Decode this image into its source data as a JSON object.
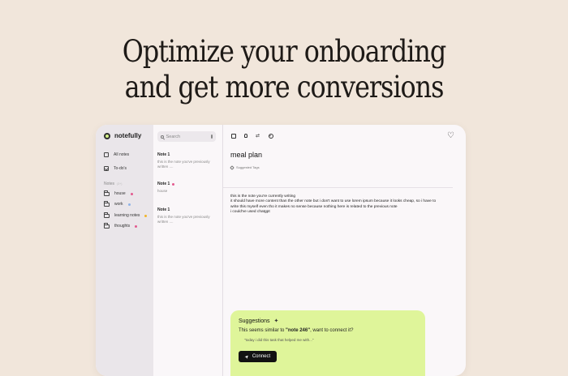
{
  "hero": {
    "line1": "Optimize your onboarding",
    "line2": "and get more conversions"
  },
  "sidebar": {
    "brand": "notefully",
    "nav": [
      {
        "label": "All notes",
        "icon": "notes-icon"
      },
      {
        "label": "To-do's",
        "icon": "checkbox-icon"
      }
    ],
    "notes_section": {
      "label": "Notes",
      "hint": "(3+)"
    },
    "folders": [
      {
        "label": "house",
        "dot_color": "#e35b8f"
      },
      {
        "label": "work",
        "dot_color": "#8fb3e8"
      },
      {
        "label": "learning notes",
        "dot_color": "#f1b52a"
      },
      {
        "label": "thoughts",
        "dot_color": "#e35b8f"
      }
    ]
  },
  "list": {
    "search_placeholder": "Search",
    "notes": [
      {
        "title": "Note 1",
        "snippet": "this is the note you've previously written ....",
        "dot_color": ""
      },
      {
        "title": "Note 1",
        "snippet": "house",
        "dot_color": "#e35b8f"
      },
      {
        "title": "Note 1",
        "snippet": "this is the note you've previously written ....",
        "dot_color": ""
      }
    ]
  },
  "editor": {
    "title": "meal plan",
    "suggested_tags": "Suggested Tags",
    "body": [
      "this is the note you're currently writing",
      "it should have more content than the other note but i don't want to use lorem ipsum because it looks cheap, so i have to",
      "write this myself even tho it makes no sense because nothing here is related to the previous note",
      "i could've used chatgpt"
    ]
  },
  "suggestions": {
    "title": "Suggestions",
    "prefix": "This seems similar to ",
    "note_name": "\"note 246\"",
    "suffix": ", want to connect it?",
    "quote": "\"today i did this task that helped me with...\"",
    "button": "Connect"
  },
  "colors": {
    "background": "#f1e6db",
    "accent": "#dff59a",
    "sidebar": "#eae6ea"
  }
}
